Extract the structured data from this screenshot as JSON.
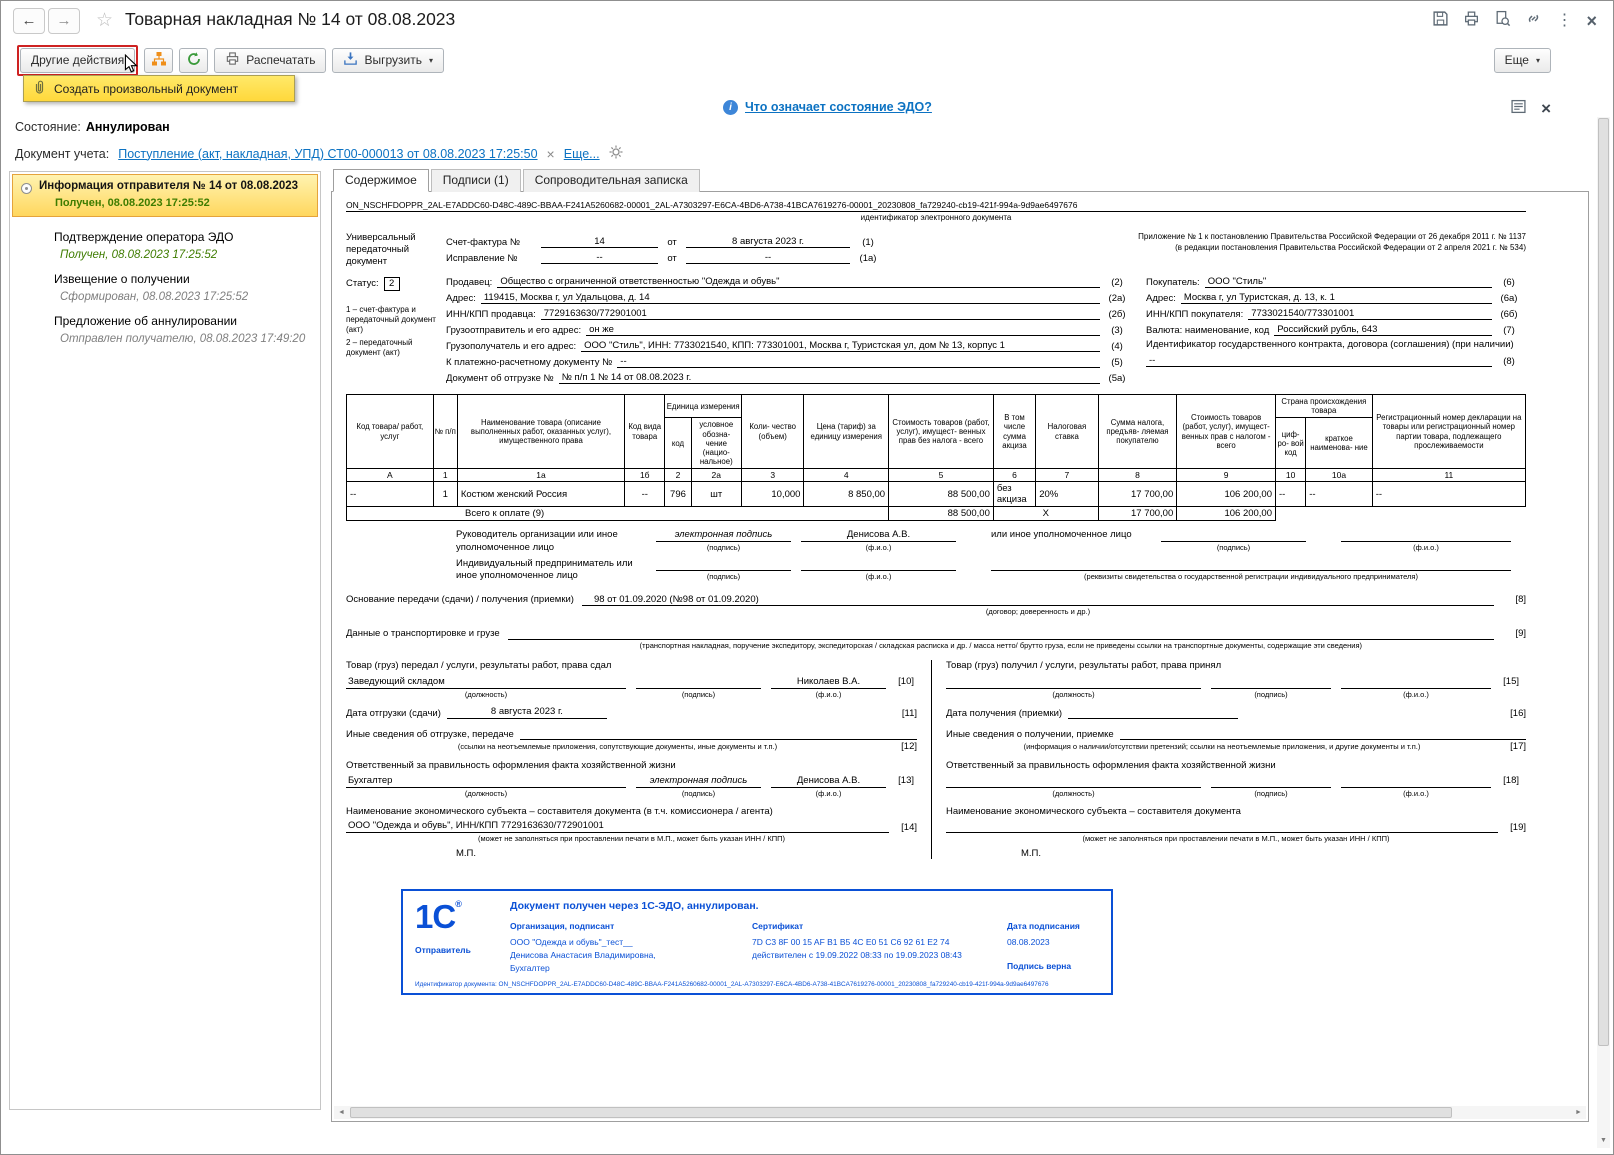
{
  "titlebar": {
    "title": "Товарная накладная № 14 от 08.08.2023"
  },
  "icons": {
    "back": "←",
    "forward": "→",
    "star": "☆",
    "kebab": "⋮",
    "close": "×",
    "caret_down": "▾",
    "info": "i",
    "clear": "×",
    "scroll_down": "▼",
    "scroll_left": "◄",
    "scroll_right": "►"
  },
  "toolbar": {
    "other_actions": "Другие действия",
    "print": "Распечатать",
    "export": "Выгрузить",
    "more": "Еще",
    "menu": {
      "create_doc": "Создать произвольный документ"
    }
  },
  "notice": {
    "edo_link": "Что означает состояние ЭДО?",
    "state_label": "Состояние:",
    "state_value": "Аннулирован",
    "accounting_label": "Документ учета:",
    "accounting_link": "Поступление (акт, накладная, УПД) СТ00-000013 от 08.08.2023 17:25:50",
    "more_link": "Еще..."
  },
  "sidebar": {
    "items": [
      {
        "title": "Информация отправителя № 14 от 08.08.2023",
        "status": "Получен, 08.08.2023 17:25:52"
      },
      {
        "title": "Подтверждение оператора ЭДО",
        "status": "Получен, 08.08.2023 17:25:52"
      },
      {
        "title": "Извещение о получении",
        "status": "Сформирован, 08.08.2023 17:25:52"
      },
      {
        "title": "Предложение об аннулировании",
        "status": "Отправлен получателю, 08.08.2023 17:49:20"
      }
    ]
  },
  "tabs": {
    "content": "Содержимое",
    "signatures": "Подписи (1)",
    "note": "Сопроводительная записка"
  },
  "doc": {
    "identifier": "ON_NSCHFDOPPR_2AL-E7ADDC60-D48C-489C-BBAA-F241A5260682-00001_2AL-A7303297-E6CA-4BD6-A738-41BCA7619276-00001_20230808_fa729240-cb19-421f-994a-9d9ae6497676",
    "identifier_caption": "идентификатор электронного документа",
    "upd_title": "Универсальный передаточный документ",
    "status_label": "Статус:",
    "status_value": "2",
    "status_note_1": "1 – счет-фактура и передаточный документ (акт)",
    "status_note_2": "2 – передаточный документ (акт)",
    "invoice_label": "Счет-фактура №",
    "invoice_no": "14",
    "from1": "от",
    "invoice_date": "8 августа 2023 г.",
    "mark_1": "(1)",
    "corr_label": "Исправление №",
    "corr_no": "--",
    "from2": "от",
    "corr_date": "--",
    "mark_1a": "(1а)",
    "appendix_1": "Приложение № 1 к постановлению Правительства Российской Федерации от 26 декабря 2011 г. № 1137",
    "appendix_2": "(в редакции постановления Правительства Российской Федерации от 2 апреля 2021 г. № 534)",
    "left_fields": [
      {
        "label": "Продавец:",
        "value": "Общество с ограниченной ответственностью \"Одежда и обувь\"",
        "mark": "(2)"
      },
      {
        "label": "Адрес:",
        "value": "119415, Москва г, ул Удальцова, д. 14",
        "mark": "(2а)"
      },
      {
        "label": "ИНН/КПП продавца:",
        "value": "7729163630/772901001",
        "mark": "(2б)"
      },
      {
        "label": "Грузоотправитель и его адрес:",
        "value": "он же",
        "mark": "(3)"
      },
      {
        "label": "Грузополучатель и его адрес:",
        "value": "ООО \"Стиль\", ИНН: 7733021540, КПП: 773301001, Москва г, Туристская ул, дом № 13, корпус 1",
        "mark": "(4)"
      },
      {
        "label": "К платежно-расчетному документу №",
        "value": "--",
        "mark": "(5)"
      },
      {
        "label": "Документ об отгрузке №",
        "value": "№ п/п 1 № 14 от 08.08.2023 г.",
        "mark": "(5а)"
      }
    ],
    "right_fields": [
      {
        "label": "Покупатель:",
        "value": "ООО \"Стиль\"",
        "mark": "(6)"
      },
      {
        "label": "Адрес:",
        "value": "Москва г, ул Туристская, д. 13, к. 1",
        "mark": "(6а)"
      },
      {
        "label": "ИНН/КПП покупателя:",
        "value": "7733021540/773301001",
        "mark": "(6б)"
      },
      {
        "label": "Валюта: наименование, код",
        "value": "Российский рубль, 643",
        "mark": "(7)"
      },
      {
        "label": "Идентификатор государственного контракта, договора (соглашения) (при наличии)",
        "value": "--",
        "mark": "(8)"
      }
    ],
    "table": {
      "headers": {
        "code": "Код товара/ работ, услуг",
        "num": "№ п/п",
        "name": "Наименование товара (описание выполненных работ, оказанных услуг), имущественного права",
        "kind": "Код вида товара",
        "unit": "Единица измерения",
        "unit_code": "код",
        "unit_sym": "условное обозна- чение (нацио- нальное)",
        "qty": "Коли- чество (объем)",
        "price": "Цена (тариф) за единицу измерения",
        "cost_no_tax": "Стоимость товаров (работ, услуг), имущест- венных прав без налога - всего",
        "excise": "В том числе сумма акциза",
        "tax_rate": "Налоговая ставка",
        "tax_amount": "Сумма налога, предъяв- ляемая покупателю",
        "cost_with_tax": "Стоимость товаров (работ, услуг), имущест- венных прав с налогом - всего",
        "country": "Страна происхождения товара",
        "country_code": "циф- ро- вой код",
        "country_name": "краткое наименова- ние",
        "reg_number": "Регистрационный номер декларации на товары или регистрационный номер партии товара, подлежащего прослеживаемости"
      },
      "letters": [
        "А",
        "1",
        "1а",
        "1б",
        "2",
        "2а",
        "3",
        "4",
        "5",
        "6",
        "7",
        "8",
        "9",
        "10",
        "10а",
        "11"
      ],
      "row": [
        "--",
        "1",
        "Костюм женский Россия",
        "--",
        "796",
        "шт",
        "10,000",
        "8 850,00",
        "88 500,00",
        "без акциза",
        "20%",
        "17 700,00",
        "106 200,00",
        "--",
        "--",
        "--"
      ],
      "total": {
        "label": "Всего к оплате (9)",
        "cost_no_tax": "88 500,00",
        "x": "X",
        "tax_amount": "17 700,00",
        "cost_with_tax": "106 200,00"
      }
    },
    "sig": {
      "head_label": "Руководитель организации или иное уполномоченное лицо",
      "esign": "электронная подпись",
      "head_fio": "Денисова А.В.",
      "cap_sign": "(подпись)",
      "cap_fio": "(ф.и.о.)",
      "other_label": "или иное уполномоченное лицо",
      "ip_label": "Индивидуальный предприниматель или иное уполномоченное лицо",
      "ip_caption": "(реквизиты свидетельства о государственной  регистрации индивидуального предпринимателя)"
    },
    "basis": {
      "basis_label": "Основание передачи (сдачи) / получения (приемки)",
      "basis_value": "98 от 01.09.2020 (№98 от 01.09.2020)",
      "basis_mark": "[8]",
      "basis_caption": "(договор; доверенность и др.)",
      "transport_label": "Данные о транспортировке и грузе",
      "transport_mark": "[9]",
      "transport_caption": "(транспортная накладная, поручение экспедитору, экспедиторская / складская расписка и др. / масса нетто/ брутто груза, если не приведены ссылки на транспортные документы, содержащие эти сведения)"
    },
    "handover": {
      "left": {
        "title": "Товар (груз) передал / услуги, результаты работ, права сдал",
        "position": "Заведующий складом",
        "fio": "Николаев В.А.",
        "cap_position": "(должность)",
        "cap_sign": "(подпись)",
        "cap_fio": "(ф.и.о.)",
        "mark_sig": "[10]",
        "date_label": "Дата отгрузки (сдачи)",
        "date_value": "8 августа 2023 г.",
        "mark_date": "[11]",
        "other_label": "Иные сведения об отгрузке, передаче",
        "mark_other": "[12]",
        "other_caption": "(ссылки на неотъемлемые приложения, сопутствующие документы, иные документы и т.п.)",
        "resp_label": "Ответственный за правильность оформления факта хозяйственной жизни",
        "resp_position": "Бухгалтер",
        "resp_sign": "электронная подпись",
        "resp_fio": "Денисова А.В.",
        "mark_resp": "[13]",
        "subject_label": "Наименование экономического субъекта – составителя документа (в т.ч. комиссионера / агента)",
        "subject_value": "ООО \"Одежда и обувь\", ИНН/КПП 7729163630/772901001",
        "mark_subject": "[14]",
        "subject_caption": "(может не заполняться при проставлении печати в М.П., может быть указан ИНН / КПП)",
        "mp": "М.П."
      },
      "right": {
        "title": "Товар (груз) получил / услуги, результаты работ, права принял",
        "cap_position": "(должность)",
        "cap_sign": "(подпись)",
        "cap_fio": "(ф.и.о.)",
        "mark_sig": "[15]",
        "date_label": "Дата получения (приемки)",
        "mark_date": "[16]",
        "other_label": "Иные сведения о получении, приемке",
        "mark_other": "[17]",
        "other_caption": "(информация о наличии/отсутствии претензий; ссылки на неотъемлемые приложения, и другие  документы и т.п.)",
        "resp_label": "Ответственный за правильность оформления факта хозяйственной жизни",
        "mark_resp": "[18]",
        "subject_label": "Наименование экономического субъекта – составителя документа",
        "mark_subject": "[19]",
        "subject_caption": "(может не заполняться при проставлении печати в М.П., может быть указан ИНН / КПП)",
        "mp": "М.П."
      }
    },
    "stamp": {
      "logo": "1С",
      "logo_reg": "®",
      "title": "Документ получен через 1С-ЭДО, аннулирован.",
      "sender_label": "Отправитель",
      "org_label": "Организация, подписант",
      "org_name": "ООО \"Одежда и обувь\"_тест__",
      "org_person": "Денисова Анастасия Владимировна,",
      "org_role": "Бухгалтер",
      "cert_label": "Сертификат",
      "cert_value": "7D C3 8F 00 15 AF B1 B5 4C E0 51 C6 92 61 E2 74",
      "cert_validity": "действителен с 19.09.2022 08:33 по 19.09.2023 08:43",
      "date_label": "Дата подписания",
      "date_value": "08.08.2023",
      "verdict": "Подпись верна",
      "doc_id_label": "Идентификатор документа:",
      "doc_id": "ON_NSCHFDOPPR_2AL-E7ADDC60-D48C-489C-BBAA-F241A5260682-00001_2AL-A7303297-E6CA-4BD6-A738-41BCA7619276-00001_20230808_fa729240-cb19-421f-994a-9d9ae6497676"
    }
  }
}
